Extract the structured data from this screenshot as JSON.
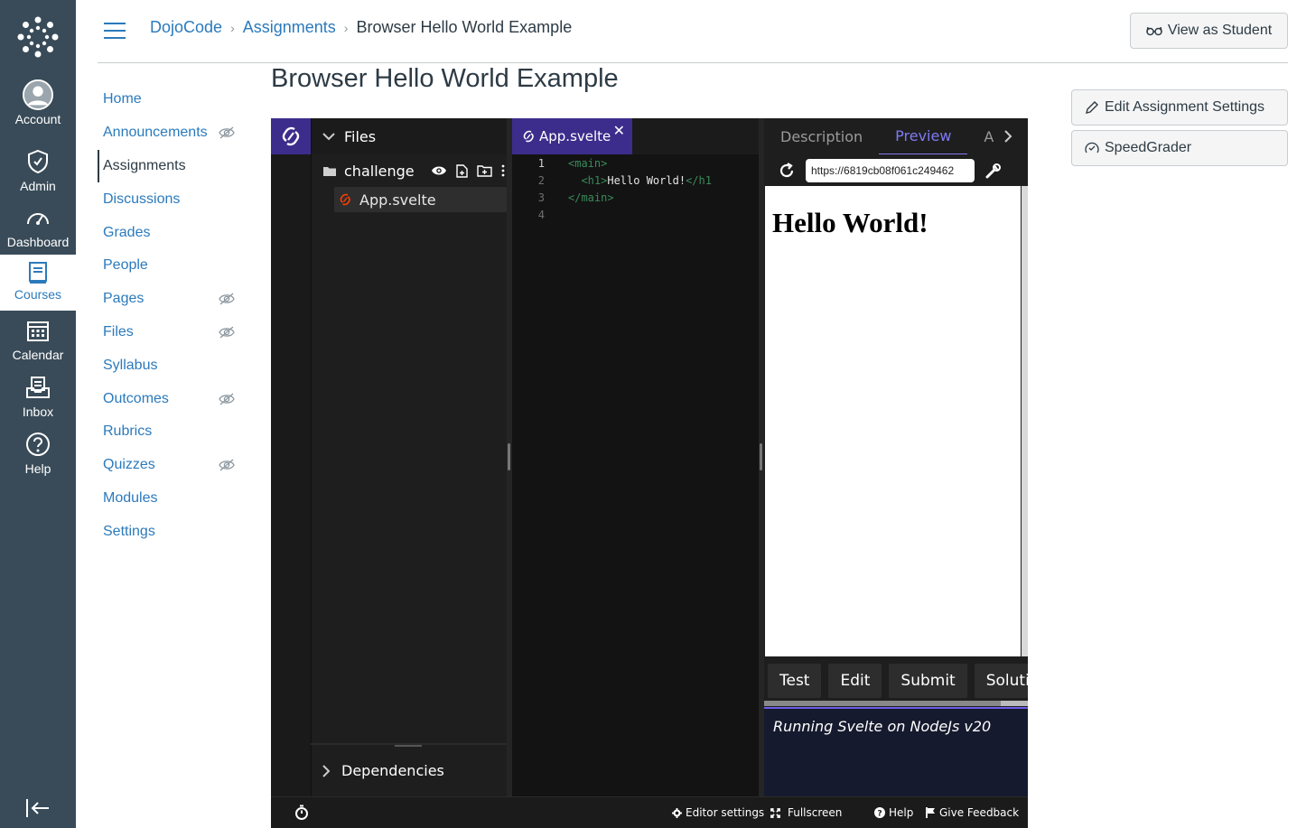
{
  "global_nav": {
    "items": [
      {
        "label": "Account",
        "icon": "account-icon"
      },
      {
        "label": "Admin",
        "icon": "shield-icon"
      },
      {
        "label": "Dashboard",
        "icon": "dashboard-icon"
      },
      {
        "label": "Courses",
        "icon": "courses-icon"
      },
      {
        "label": "Calendar",
        "icon": "calendar-icon"
      },
      {
        "label": "Inbox",
        "icon": "inbox-icon"
      },
      {
        "label": "Help",
        "icon": "help-icon"
      }
    ],
    "active": "Courses"
  },
  "breadcrumb": {
    "items": [
      "DojoCode",
      "Assignments",
      "Browser Hello World Example"
    ]
  },
  "header": {
    "view_as_student": "View as Student"
  },
  "course_nav": {
    "items": [
      {
        "label": "Home",
        "hidden": false
      },
      {
        "label": "Announcements",
        "hidden": true
      },
      {
        "label": "Assignments",
        "hidden": false,
        "active": true
      },
      {
        "label": "Discussions",
        "hidden": false
      },
      {
        "label": "Grades",
        "hidden": false
      },
      {
        "label": "People",
        "hidden": false
      },
      {
        "label": "Pages",
        "hidden": true
      },
      {
        "label": "Files",
        "hidden": true
      },
      {
        "label": "Syllabus",
        "hidden": false
      },
      {
        "label": "Outcomes",
        "hidden": true
      },
      {
        "label": "Rubrics",
        "hidden": false
      },
      {
        "label": "Quizzes",
        "hidden": true
      },
      {
        "label": "Modules",
        "hidden": false
      },
      {
        "label": "Settings",
        "hidden": false
      }
    ]
  },
  "page": {
    "title": "Browser Hello World Example"
  },
  "side_buttons": {
    "edit_settings": "Edit Assignment Settings",
    "speedgrader": "SpeedGrader"
  },
  "ide": {
    "files_title": "Files",
    "folder": "challenge",
    "file": "App.svelte",
    "dependencies": "Dependencies",
    "editor_tab": "App.svelte",
    "code_lines": [
      {
        "num": "1",
        "indent": "",
        "open": "<main>",
        "text": "",
        "close": ""
      },
      {
        "num": "2",
        "indent": "  ",
        "open": "<h1>",
        "text": "Hello World!",
        "close": "</h1"
      },
      {
        "num": "3",
        "indent": "",
        "open": "</main>",
        "text": "",
        "close": ""
      },
      {
        "num": "4",
        "indent": "",
        "open": "",
        "text": "",
        "close": ""
      }
    ],
    "preview_tabs": [
      "Description",
      "Preview",
      "A"
    ],
    "active_preview_tab": "Preview",
    "url": "https://6819cb08f061c249462",
    "preview_heading": "Hello World!",
    "actions": [
      "Test",
      "Edit",
      "Submit",
      "Solution"
    ],
    "console_text": "Running Svelte on NodeJs v20",
    "status": {
      "editor_settings": "Editor settings",
      "fullscreen": "Fullscreen",
      "help": "Help",
      "feedback": "Give Feedback"
    },
    "accent": "#3c2d8c"
  },
  "colors": {
    "nav_bg": "#394b58",
    "link": "#2b7abc",
    "text": "#2d3b45"
  }
}
